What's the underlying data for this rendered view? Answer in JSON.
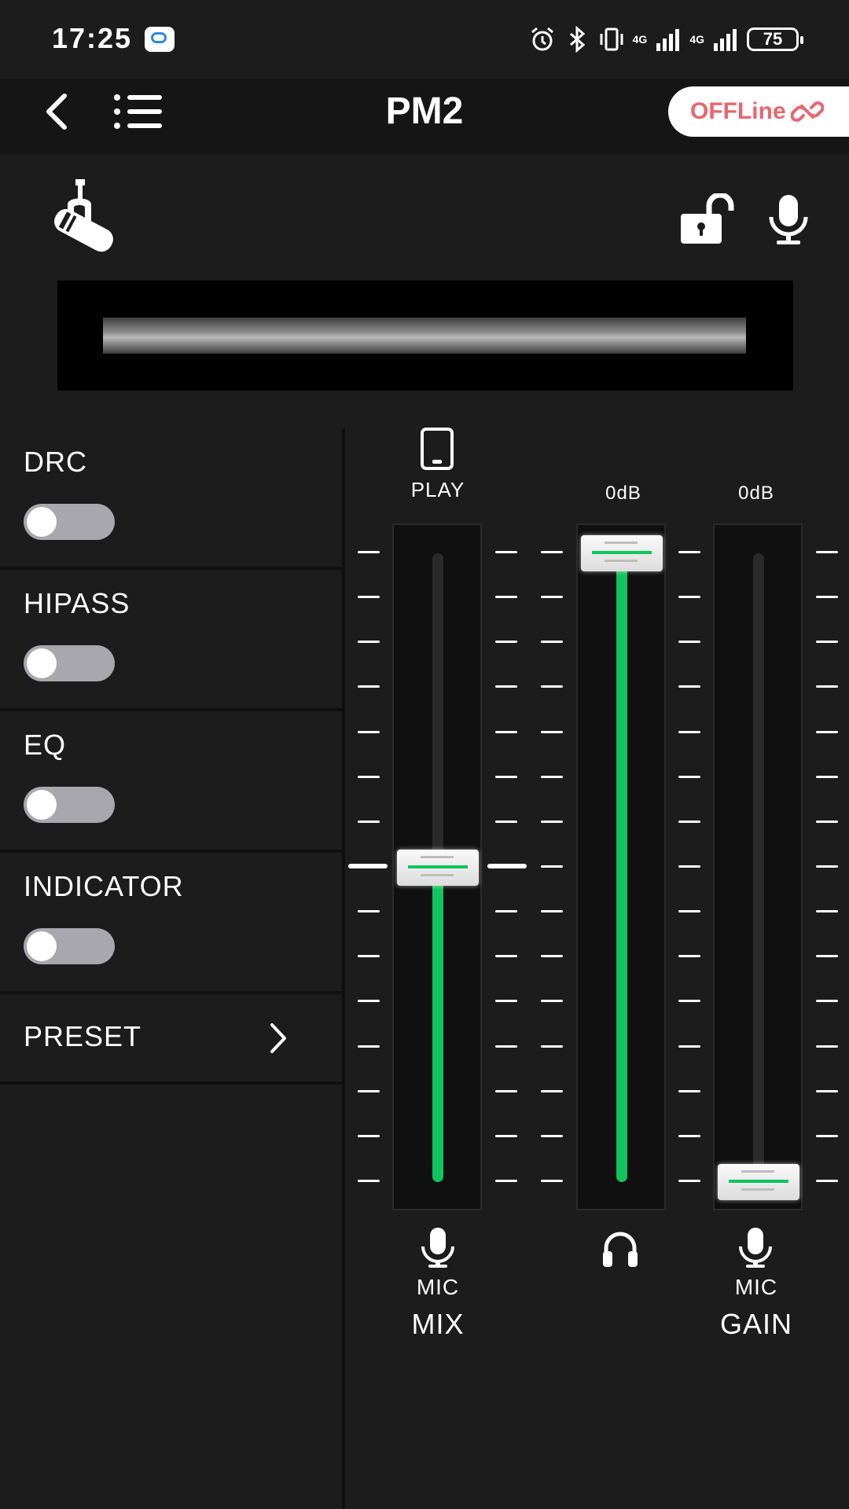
{
  "status_bar": {
    "time": "17:25",
    "network_1": "4G",
    "network_2": "4G",
    "battery": "75",
    "icons": [
      "chat-app-icon",
      "alarm-icon",
      "bluetooth-icon",
      "vibrate-icon",
      "signal-icon",
      "signal-icon",
      "battery-icon"
    ]
  },
  "app_bar": {
    "title": "PM2",
    "connection_status": "OFFLine",
    "status_color": "#e8666f"
  },
  "meter": {
    "level": 1.0
  },
  "settings": [
    {
      "label": "DRC",
      "enabled": false
    },
    {
      "label": "HIPASS",
      "enabled": false
    },
    {
      "label": "EQ",
      "enabled": false
    },
    {
      "label": "INDICATOR",
      "enabled": false
    }
  ],
  "preset": {
    "label": "PRESET"
  },
  "faders": [
    {
      "top_label": "PLAY",
      "top_icon": "phone-icon",
      "bottom_icon": "microphone-icon",
      "sub_label": "MIC",
      "name": "MIX",
      "level": 0.5
    },
    {
      "top_label": "0dB",
      "bottom_icon": "headphones-icon",
      "sub_label": "",
      "name": "",
      "level": 1.0
    },
    {
      "top_label": "0dB",
      "bottom_icon": "microphone-icon",
      "sub_label": "MIC",
      "name": "GAIN",
      "level": 0.0
    }
  ],
  "colors": {
    "accent": "#10c45e",
    "background": "#1c1c1c",
    "appbar": "#151515"
  }
}
